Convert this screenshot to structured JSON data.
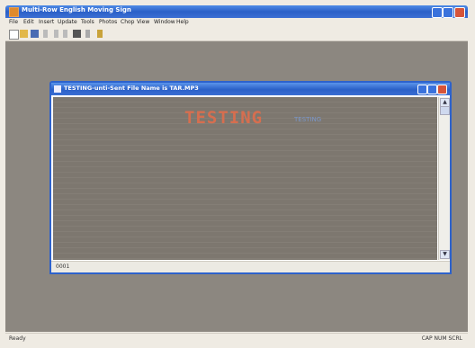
{
  "app": {
    "title": "Multi-Row English Moving Sign",
    "menu": [
      "File",
      "Edit",
      "Insert",
      "Update",
      "Tools",
      "Photos",
      "Chop",
      "View",
      "Window",
      "Help"
    ]
  },
  "child_window": {
    "title": "TESTING-unti-Sent File Name is TAR.MP3",
    "doc_text": "TESTING",
    "doc_tag": "TESTING",
    "position": "0001"
  },
  "status": {
    "left": "Ready",
    "right": "CAP NUM SCRL"
  },
  "colors": {
    "titlebar": "#2b60c8",
    "doc_bg": "#7d776f",
    "doc_text": "#d66e4f"
  }
}
